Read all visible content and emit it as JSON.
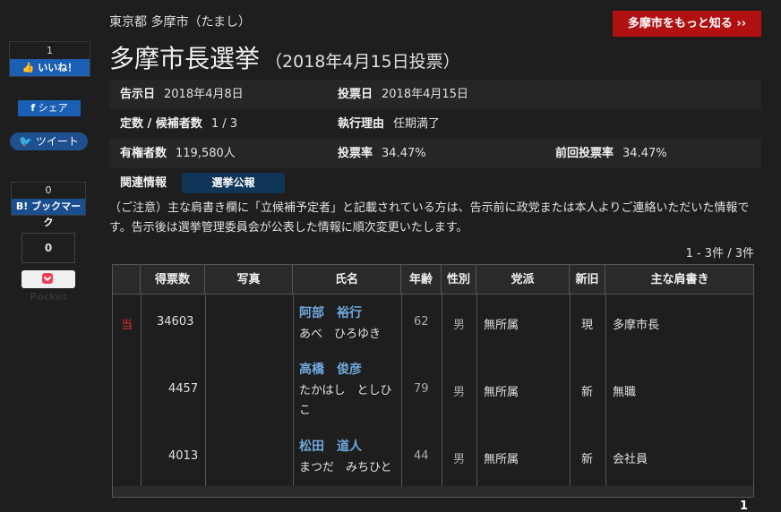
{
  "social": {
    "fb_like_count": "1",
    "fb_like_label": "いいね！",
    "fb_share_label": "シェア",
    "tweet_label": "ツイート",
    "hatena_count": "0",
    "hatena_label": "ブックマーク",
    "pocket_count": "0",
    "pocket_label": "Pocket"
  },
  "header": {
    "breadcrumb": "東京都 多摩市（たまし）",
    "more_button": "多摩市をもっと知る ››",
    "title": "多摩市長選挙",
    "subtitle": "（2018年4月15日投票）"
  },
  "info": {
    "announce_key": "告示日",
    "announce_val": "2018年4月8日",
    "vote_day_key": "投票日",
    "vote_day_val": "2018年4月15日",
    "seats_key": "定数 / 候補者数",
    "seats_val": "1 / 3",
    "reason_key": "執行理由",
    "reason_val": "任期満了",
    "electorate_key": "有権者数",
    "electorate_val": "119,580人",
    "turnout_key": "投票率",
    "turnout_val": "34.47%",
    "prev_turnout_key": "前回投票率",
    "prev_turnout_val": "34.47%",
    "related_key": "関連情報",
    "related_button": "選挙公報"
  },
  "note": "（ご注意）主な肩書き欄に「立候補予定者」と記載されている方は、告示前に政党または本人よりご連絡いただいた情報です。告示後は選挙管理委員会が公表した情報に順次変更いたします。",
  "count_line": "1 - 3件 / 3件",
  "table": {
    "headers": {
      "votes": "得票数",
      "photo": "写真",
      "name": "氏名",
      "age": "年齢",
      "sex": "性別",
      "party": "党派",
      "new_old": "新旧",
      "career": "主な肩書き"
    },
    "rows": [
      {
        "mark": "当",
        "votes": "34603",
        "name": "阿部　裕行",
        "kana": "あべ　ひろゆき",
        "age": "62",
        "sex": "男",
        "party": "無所属",
        "new_old": "現",
        "career": "多摩市長"
      },
      {
        "mark": "",
        "votes": "4457",
        "name": "高橋　俊彦",
        "kana": "たかはし　としひこ",
        "age": "79",
        "sex": "男",
        "party": "無所属",
        "new_old": "新",
        "career": "無職"
      },
      {
        "mark": "",
        "votes": "4013",
        "name": "松田　道人",
        "kana": "まつだ　みちひと",
        "age": "44",
        "sex": "男",
        "party": "無所属",
        "new_old": "新",
        "career": "会社員"
      }
    ]
  },
  "pagination": "1"
}
